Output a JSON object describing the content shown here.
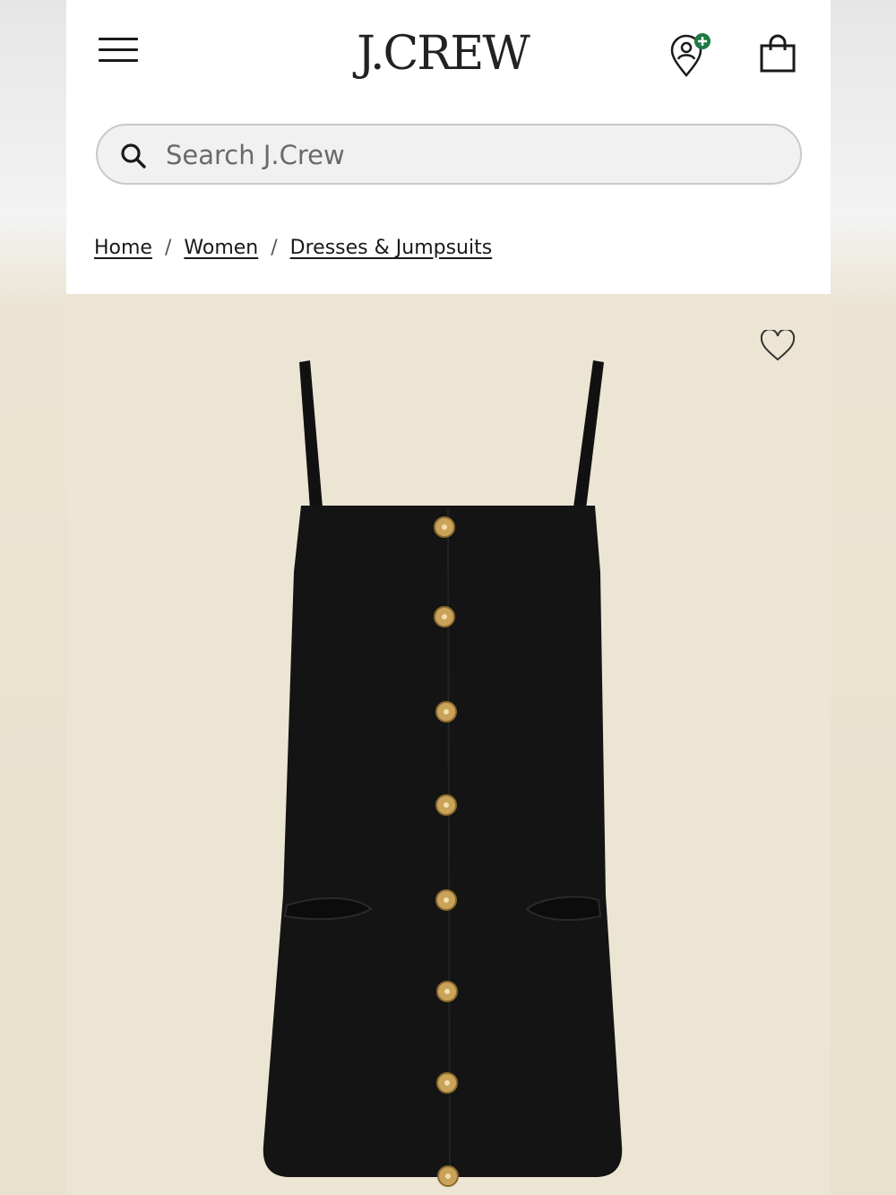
{
  "header": {
    "logo": "J.CREW",
    "menu_icon": "hamburger-menu-icon",
    "store_icon": "store-locator-add-icon",
    "bag_icon": "shopping-bag-icon"
  },
  "search": {
    "placeholder": "Search J.Crew",
    "value": "",
    "icon": "search-icon"
  },
  "breadcrumb": {
    "items": [
      {
        "label": "Home"
      },
      {
        "label": "Women"
      },
      {
        "label": "Dresses & Jumpsuits"
      }
    ],
    "separator": "/"
  },
  "product": {
    "image": "black-button-front-mini-dress",
    "wishlist_icon": "heart-icon"
  },
  "colors": {
    "accent_green": "#1d7a45",
    "product_background": "#ece5d3",
    "text": "#1a1a1a"
  }
}
